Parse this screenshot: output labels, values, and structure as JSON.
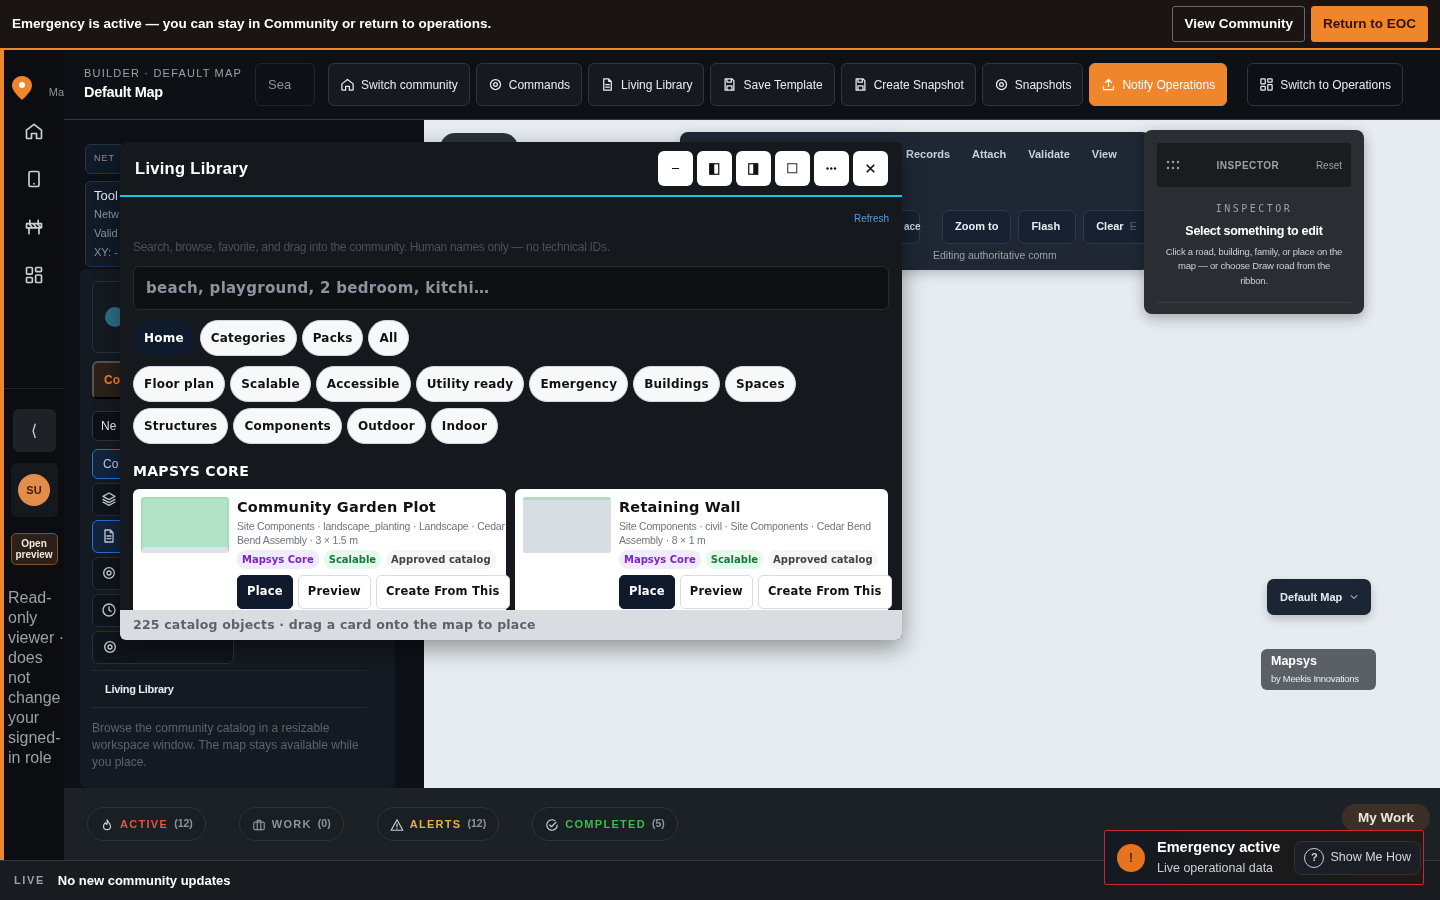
{
  "banner": {
    "message": "Emergency is active — you can stay in Community or return to operations.",
    "buttons": [
      {
        "label": "View Community",
        "kind": "outline"
      },
      {
        "label": "Return to EOC",
        "kind": "primary"
      }
    ]
  },
  "rail": {
    "brand": "Ma",
    "collapse": "⟨",
    "avatar": "SU",
    "preview_button": "Open preview",
    "note": "Read-only viewer · does not change your signed-in role"
  },
  "header": {
    "eyebrow": "BUILDER · DEFAULT MAP",
    "title": "Default Map",
    "search_placeholder": "Sea",
    "buttons": [
      {
        "label": "Switch community",
        "kind": "ghost"
      },
      {
        "label": "Commands",
        "kind": "ghost"
      },
      {
        "label": "Living Library",
        "kind": "ghost"
      },
      {
        "label": "Save Template",
        "kind": "ghost"
      },
      {
        "label": "Create Snapshot",
        "kind": "ghost"
      },
      {
        "label": "Snapshots",
        "kind": "ghost"
      },
      {
        "label": "Notify Operations",
        "kind": "primary"
      },
      {
        "label": "Switch to Operations",
        "kind": "ghost"
      }
    ]
  },
  "left_panel": {
    "cards": [
      {
        "lines": [
          "NET"
        ]
      },
      {
        "lines": [
          "Tool",
          "Netw",
          "Valid",
          "XY: -"
        ]
      }
    ],
    "chips": [
      {
        "label": "Co",
        "kind": "warning"
      },
      {
        "label": "Ne",
        "kind": "plain"
      },
      {
        "label": "Co",
        "kind": "info"
      }
    ],
    "tools": [
      {
        "selected": false
      },
      {
        "selected": true
      },
      {
        "selected": false
      },
      {
        "selected": false
      },
      {
        "selected": false
      }
    ],
    "section_title": "Living Library",
    "description": "Browse the community catalog in a resizable workspace window. The map stays available while you place."
  },
  "ribbon": {
    "menu": [
      "Records",
      "Attach",
      "Validate",
      "View"
    ],
    "actions": [
      "ace",
      "Zoom to",
      "Flash",
      "Clear"
    ],
    "action_hint": "E",
    "note": "Editing authoritative comm"
  },
  "inspector": {
    "handle_title": "INSPECTOR",
    "reset": "Reset",
    "eyebrow": "INSPECTOR",
    "heading": "Select something to edit",
    "body": "Click a road, building, family, or place on the map — or choose Draw road from the ribbon."
  },
  "map": {
    "switcher": "Default Map",
    "brand": {
      "name": "Mapsys",
      "byline": "by Meekis Innovations"
    }
  },
  "library": {
    "title": "Living Library",
    "refresh": "Refresh",
    "subtitle": "Search, browse, favorite, and drag into the community. Human names only — no technical IDs.",
    "search_placeholder": "beach, playground, 2 bedroom, kitchi…",
    "nav_pills": [
      {
        "label": "Home",
        "selected": true
      },
      {
        "label": "Categories",
        "selected": false
      },
      {
        "label": "Packs",
        "selected": false
      },
      {
        "label": "All",
        "selected": false
      }
    ],
    "tags": [
      "Floor plan",
      "Scalable",
      "Accessible",
      "Utility ready",
      "Emergency",
      "Buildings",
      "Spaces",
      "Structures",
      "Components",
      "Outdoor",
      "Indoor"
    ],
    "section": "MAPSYS CORE",
    "cards": [
      {
        "title": "Community Garden Plot",
        "meta": "Site Components · landscape_planting · Landscape · Cedar Bend Assembly · 3 × 1.5 m",
        "kind": "planting",
        "tags": [
          {
            "label": "Mapsys Core",
            "kind": "brand"
          },
          {
            "label": "Scalable",
            "kind": "success"
          },
          {
            "label": "Approved catalog",
            "kind": "plain"
          }
        ],
        "actions": [
          {
            "label": "Place",
            "kind": "primary"
          },
          {
            "label": "Preview",
            "kind": "outline"
          },
          {
            "label": "Create From This",
            "kind": "outline"
          }
        ]
      },
      {
        "title": "Retaining Wall",
        "meta": "Site Components · civil · Site Components · Cedar Bend Assembly · 8 × 1 m",
        "kind": "wall",
        "tags": [
          {
            "label": "Mapsys Core",
            "kind": "brand"
          },
          {
            "label": "Scalable",
            "kind": "success"
          },
          {
            "label": "Approved catalog",
            "kind": "plain"
          }
        ],
        "actions": [
          {
            "label": "Place",
            "kind": "primary"
          },
          {
            "label": "Preview",
            "kind": "outline"
          },
          {
            "label": "Create From This",
            "kind": "outline"
          }
        ]
      }
    ],
    "footer": "225 catalog objects · drag a card onto the map to place"
  },
  "bottom_tabs": [
    {
      "label": "ACTIVE",
      "count": "(12)",
      "color": "#e5534b"
    },
    {
      "label": "WORK",
      "count": "(0)",
      "color": "#8b949e"
    },
    {
      "label": "ALERTS",
      "count": "(12)",
      "color": "#e3b341"
    },
    {
      "label": "COMPLETED",
      "count": "(5)",
      "color": "#3fb950"
    }
  ],
  "my_work": "My Work",
  "toast": {
    "icon": "!",
    "title": "Emergency active",
    "subtitle": "Live operational data",
    "help_icon": "?",
    "help": "Show Me How"
  },
  "status": {
    "tag": "LIVE",
    "message": "No new community updates"
  }
}
